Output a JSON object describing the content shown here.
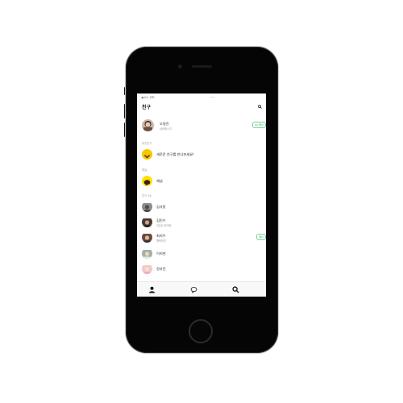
{
  "status": {
    "carrier": "◀ U+ LTE",
    "time": "··:··"
  },
  "header": {
    "title": "친구"
  },
  "me": {
    "name": "오영진",
    "status": "상태메시지",
    "badge": "My 멀티"
  },
  "recommend": {
    "label": "추천친구",
    "item": "새로운 친구를 만나보세요!"
  },
  "channel": {
    "label": "채널",
    "item": "채널"
  },
  "friends": {
    "label": "친구 16",
    "items": [
      {
        "name": "김사랑",
        "status": "",
        "badge": ""
      },
      {
        "name": "김민수",
        "status": "오늘도 화이팅",
        "badge": ""
      },
      {
        "name": "최지우",
        "status": "행복하자",
        "badge": "멀티"
      },
      {
        "name": "이지현",
        "status": "",
        "badge": ""
      },
      {
        "name": "정유진",
        "status": "",
        "badge": ""
      }
    ]
  },
  "tabs": [
    {
      "icon": "person-icon"
    },
    {
      "icon": "chat-bubble-icon"
    },
    {
      "icon": "search-icon"
    }
  ]
}
